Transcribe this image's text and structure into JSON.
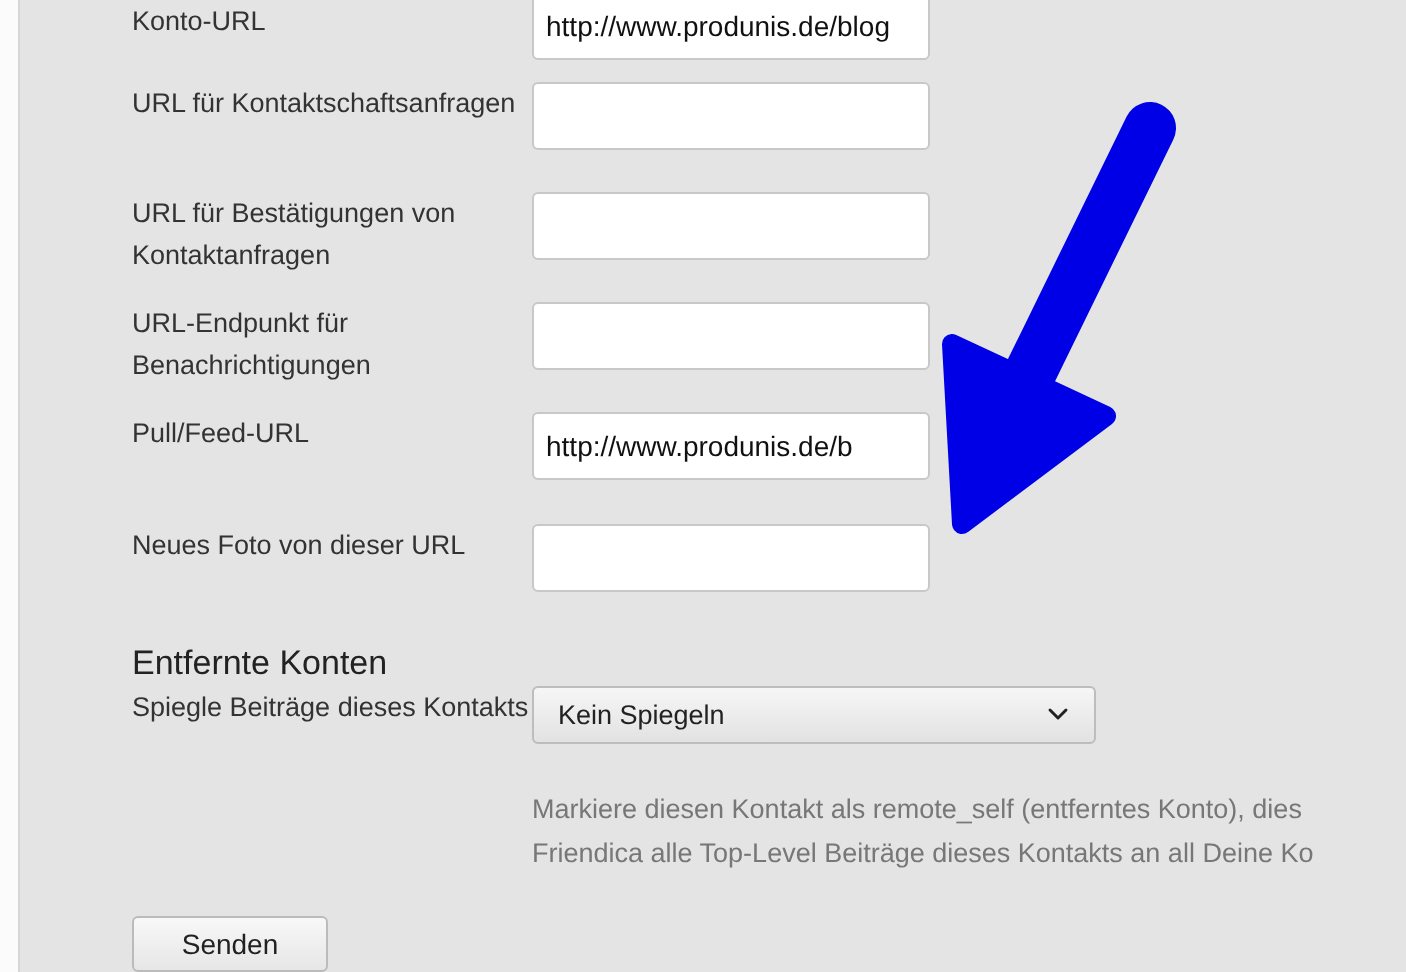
{
  "fields": [
    {
      "label": "Konto-URL",
      "value": "http://www.produnis.de/blog"
    },
    {
      "label": "URL für Kontaktschaftsanfragen"
    },
    {
      "label": "URL für Bestätigungen von Kontaktanfragen"
    },
    {
      "label": "URL-Endpunkt für Benachrichtigungen"
    },
    {
      "label": "Pull/Feed-URL",
      "value": "http://www.produnis.de/b"
    },
    {
      "label": "Neues Foto von dieser URL"
    }
  ],
  "remote_section": {
    "heading": "Entfernte Konten",
    "mirror_label": "Spiegle Beiträge dieses Kontakts",
    "mirror_select": {
      "value": "Kein Spiegeln"
    },
    "help_lines": [
      "Markiere diesen Kontakt als remote_self (entferntes Konto), dies",
      "Friendica alle Top-Level Beiträge dieses Kontakts an all Deine Ko"
    ]
  },
  "submit_button": "Senden"
}
